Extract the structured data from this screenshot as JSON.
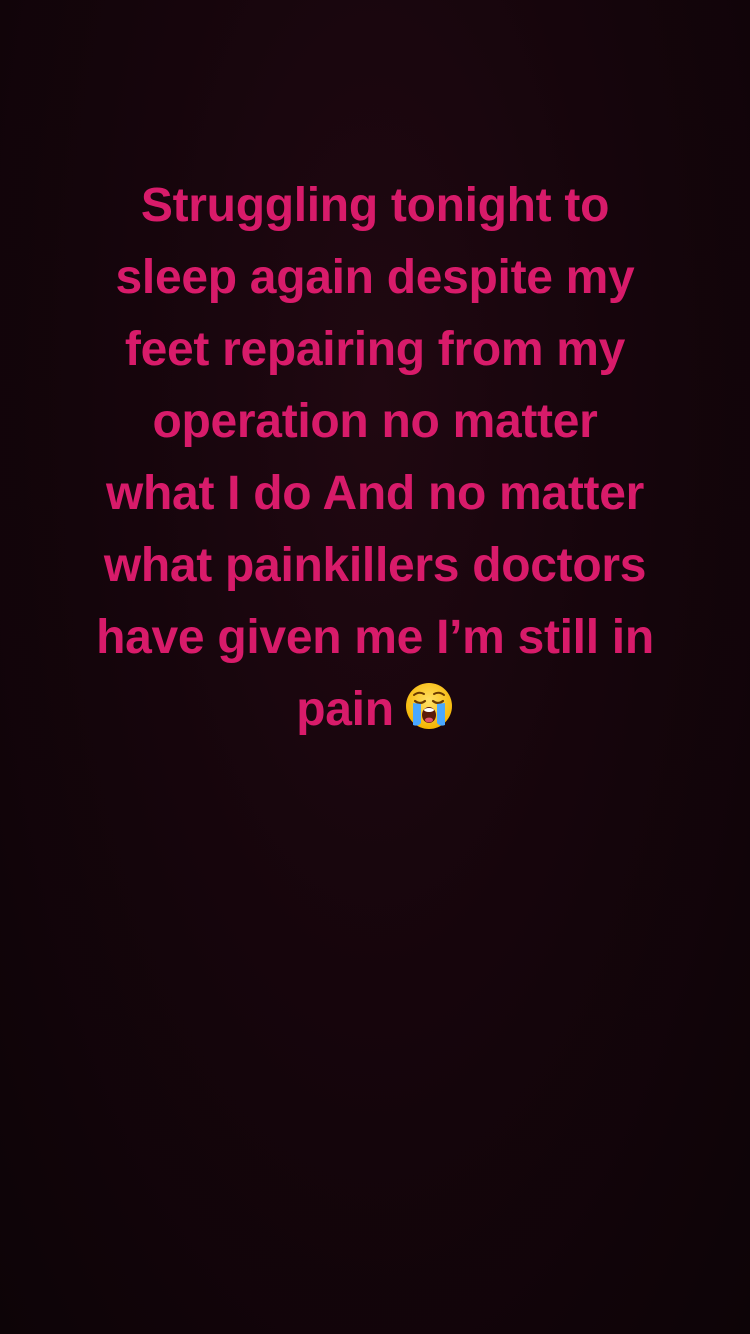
{
  "story": {
    "caption_lines": [
      "Struggling  tonight to",
      "sleep again despite my",
      "feet repairing from my",
      "operation no matter",
      "what I do And no matter",
      "what painkillers doctors",
      "have given me I’m still in",
      "pain"
    ],
    "emoji": "loudly-crying-face",
    "text_color": "#d81b6a",
    "background_color": "#0e0408"
  }
}
